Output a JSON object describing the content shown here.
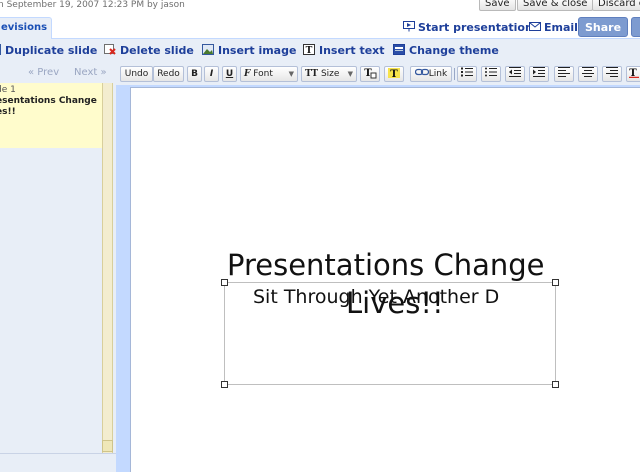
{
  "header": {
    "edited_text": "n September 19, 2007 12:23 PM by jason",
    "save_label": "Save",
    "save_close_label": "Save & close",
    "discard_label": "Discard c"
  },
  "tabs": {
    "revisions_label": "evisions",
    "start_presentation_label": "Start presentation",
    "email_label": "Email",
    "share_label": "Share"
  },
  "actions": {
    "duplicate_slide": "Duplicate slide",
    "delete_slide": "Delete slide",
    "insert_image": "Insert image",
    "insert_text": "Insert text",
    "change_theme": "Change theme"
  },
  "slides_panel": {
    "prev_label": "« Prev",
    "next_label": "Next »",
    "thumb_number": "de 1",
    "thumb_title_line1": "esentations Change",
    "thumb_title_line2": "es!!"
  },
  "format_toolbar": {
    "undo": "Undo",
    "redo": "Redo",
    "bold": "B",
    "italic": "I",
    "underline": "U",
    "font": "Font",
    "size": "Size",
    "link": "Link"
  },
  "slide": {
    "title_line1": "Presentations Change",
    "title_line2": "Lives!!",
    "subtitle": "Sit Through Yet Another D"
  },
  "colors": {
    "accent": "#1e3f9a",
    "toolbar_bg": "#e8eef7",
    "share_button": "#7d9bd0",
    "thumb_bg": "#fffccc"
  }
}
